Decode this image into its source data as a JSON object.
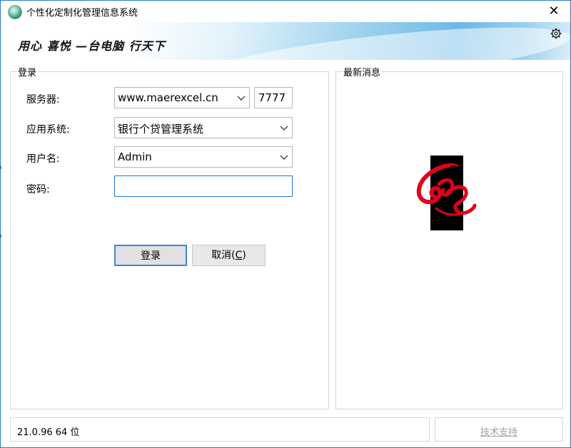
{
  "window": {
    "title": "个性化定制化管理信息系统",
    "close_glyph": "✕"
  },
  "banner": {
    "slogan": "用心 喜悦 —台电脑 行天下"
  },
  "login": {
    "legend": "登录",
    "server_label": "服务器:",
    "server_value": "www.maerexcel.cn",
    "port_value": "7777",
    "app_label": "应用系统:",
    "app_value": "银行个贷管理系统",
    "user_label": "用户名:",
    "user_value": "Admin",
    "password_label": "密码:",
    "password_value": "",
    "login_button": "登录",
    "cancel_button_prefix": "取消(",
    "cancel_button_accel": "C",
    "cancel_button_suffix": ")"
  },
  "news": {
    "legend": "最新消息"
  },
  "status": {
    "version": "21.0.96 64 位",
    "support_link": "技术支持"
  },
  "colors": {
    "accent": "#2b79d0",
    "focus_border": "#1e7ad6",
    "logo_red": "#e0001a"
  },
  "icons": {
    "app": "globe-icon",
    "close": "close-icon",
    "settings": "gear-icon",
    "dropdown": "chevron-down-icon"
  }
}
